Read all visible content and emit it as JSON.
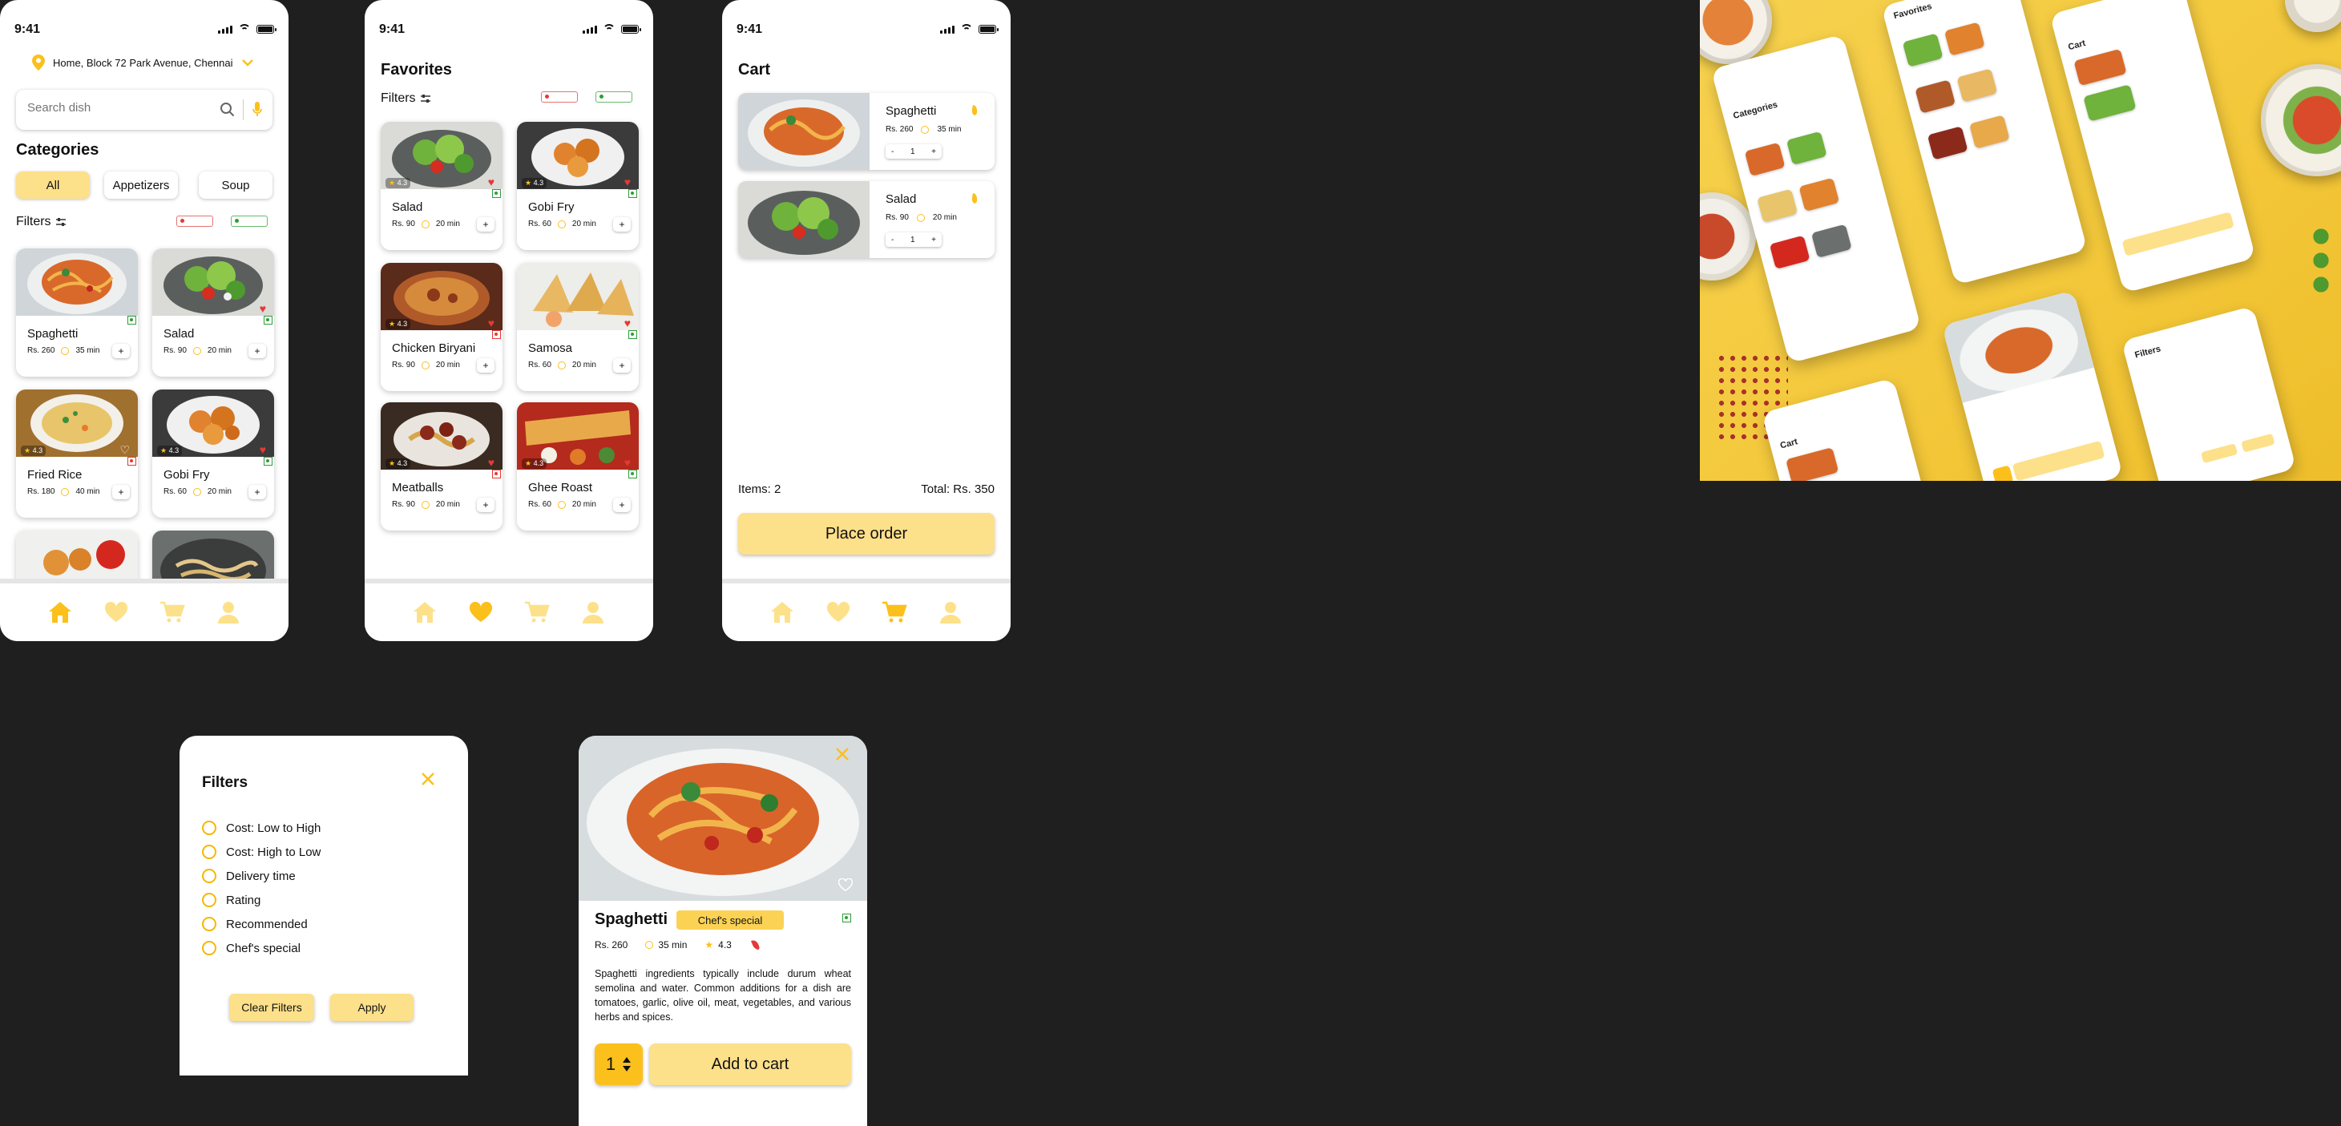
{
  "status_time": "9:41",
  "home": {
    "location": "Home, Block 72 Park Avenue, Chennai",
    "search_placeholder": "Search dish",
    "categories_title": "Categories",
    "categories": [
      "All",
      "Appetizers",
      "Soup"
    ],
    "filters_label": "Filters",
    "cards": [
      {
        "name": "Spaghetti",
        "price": "Rs. 260",
        "time": "35 min",
        "rating": "",
        "veg": true
      },
      {
        "name": "Salad",
        "price": "Rs. 90",
        "time": "20 min",
        "rating": "",
        "veg": true
      },
      {
        "name": "Fried Rice",
        "price": "Rs. 180",
        "time": "40 min",
        "rating": "4.3",
        "veg": false
      },
      {
        "name": "Gobi Fry",
        "price": "Rs. 60",
        "time": "20 min",
        "rating": "4.3",
        "veg": true
      }
    ]
  },
  "favorites": {
    "title": "Favorites",
    "filters_label": "Filters",
    "cards": [
      {
        "name": "Salad",
        "price": "Rs. 90",
        "time": "20 min",
        "rating": "4.3",
        "veg": true
      },
      {
        "name": "Gobi Fry",
        "price": "Rs. 60",
        "time": "20 min",
        "rating": "4.3",
        "veg": true
      },
      {
        "name": "Chicken Biryani",
        "price": "Rs. 90",
        "time": "20 min",
        "rating": "4.3",
        "veg": false
      },
      {
        "name": "Samosa",
        "price": "Rs. 60",
        "time": "20 min",
        "rating": "",
        "veg": true
      },
      {
        "name": "Meatballs",
        "price": "Rs. 90",
        "time": "20 min",
        "rating": "4.3",
        "veg": false
      },
      {
        "name": "Ghee Roast",
        "price": "Rs. 60",
        "time": "20 min",
        "rating": "4.3",
        "veg": true
      }
    ]
  },
  "cart": {
    "title": "Cart",
    "items": [
      {
        "name": "Spaghetti",
        "price": "Rs. 260",
        "time": "35 min",
        "qty": "1"
      },
      {
        "name": "Salad",
        "price": "Rs. 90",
        "time": "20 min",
        "qty": "1"
      }
    ],
    "items_label": "Items: 2",
    "total_label": "Total: Rs. 350",
    "place_order": "Place order"
  },
  "filters_sheet": {
    "title": "Filters",
    "options": [
      "Cost: Low to High",
      "Cost: High to Low",
      "Delivery time",
      "Rating",
      "Recommended",
      "Chef's special"
    ],
    "clear": "Clear Filters",
    "apply": "Apply"
  },
  "detail": {
    "name": "Spaghetti",
    "badge": "Chef's special",
    "price": "Rs. 260",
    "time": "35 min",
    "rating": "4.3",
    "description": "Spaghetti ingredients typically include durum wheat semolina and water. Common additions for a dish are tomatoes, garlic, olive oil, meat, vegetables, and various herbs and spices.",
    "qty": "1",
    "add_to_cart": "Add to cart"
  },
  "colors": {
    "accent": "#fcc01c",
    "accent_light": "#fde08a",
    "background": "#1f1f1f",
    "veg": "#2e9d3a",
    "nonveg": "#e53935"
  },
  "icons": [
    "location-pin-icon",
    "chevron-down-icon",
    "search-icon",
    "mic-icon",
    "filter-icon",
    "home-icon",
    "heart-icon",
    "cart-icon",
    "user-icon",
    "close-icon",
    "clock-icon",
    "star-icon",
    "chili-icon"
  ]
}
